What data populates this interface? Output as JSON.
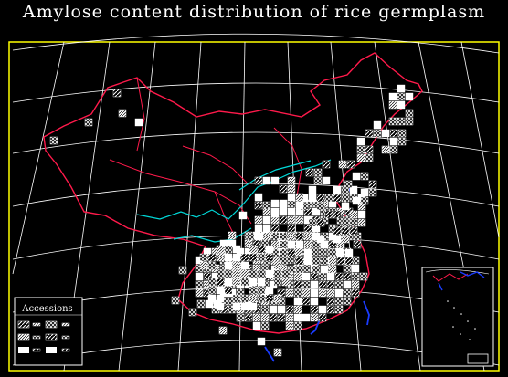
{
  "title": "Amylose content distribution of rice germplasm",
  "legend": {
    "title": "Accessions",
    "items": [
      {
        "pattern": "hatch-sparse"
      },
      {
        "pattern": "hatch-cross"
      },
      {
        "pattern": "hatch-dense"
      },
      {
        "pattern": "dots"
      },
      {
        "pattern": "grid"
      },
      {
        "pattern": "solid"
      }
    ]
  },
  "colors": {
    "background": "#000000",
    "frame": "#ffff00",
    "graticule": "#ffffff",
    "border": "#ff1a4b",
    "river": "#00d8d8",
    "sea": "#1a3cff",
    "accession_cell": "#ffffff"
  }
}
